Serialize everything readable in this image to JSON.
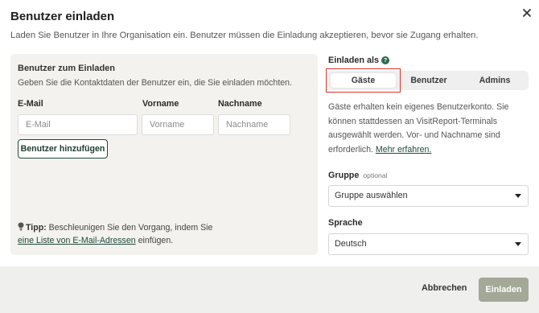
{
  "dialog": {
    "title": "Benutzer einladen",
    "subtitle": "Laden Sie Benutzer in Ihre Organisation ein. Benutzer müssen die Einladung akzeptieren, bevor sie Zugang erhalten.",
    "close_icon": "close-icon"
  },
  "left": {
    "title": "Benutzer zum Einladen",
    "subtitle": "Geben Sie die Kontaktdaten der Benutzer ein, die Sie einladen möchten.",
    "email_label": "E-Mail",
    "firstname_label": "Vorname",
    "lastname_label": "Nachname",
    "email_placeholder": "E-Mail",
    "firstname_placeholder": "Vorname",
    "lastname_placeholder": "Nachname",
    "add_button": "Benutzer hinzufügen",
    "tip_label": "Tipp:",
    "tip_text": " Beschleunigen Sie den Vorgang, indem Sie",
    "tip_link": "eine Liste von E-Mail-Adressen",
    "tip_suffix": " einfügen.",
    "tip_icon": "lightbulb-icon"
  },
  "right": {
    "invite_as_label": "Einladen als",
    "help_icon": "help-icon",
    "help_glyph": "?",
    "segments": [
      "Gäste",
      "Benutzer",
      "Admins"
    ],
    "selected_segment": "Gäste",
    "description": "Gäste erhalten kein eigenes Benutzerkonto. Sie können stattdessen an VisitReport-Terminals ausgewählt werden. Vor- und Nachname sind erforderlich.",
    "more_link": "Mehr erfahren.",
    "group_label": "Gruppe",
    "group_optional": "optional",
    "group_value": "Gruppe auswählen",
    "language_label": "Sprache",
    "language_value": "Deutsch",
    "dropdown_icon": "chevron-down-icon"
  },
  "footer": {
    "cancel": "Abbrechen",
    "invite": "Einladen"
  },
  "colors": {
    "brand_green": "#1f4a3c",
    "invite_button": "#a3a897",
    "highlight": "#d9342b"
  }
}
